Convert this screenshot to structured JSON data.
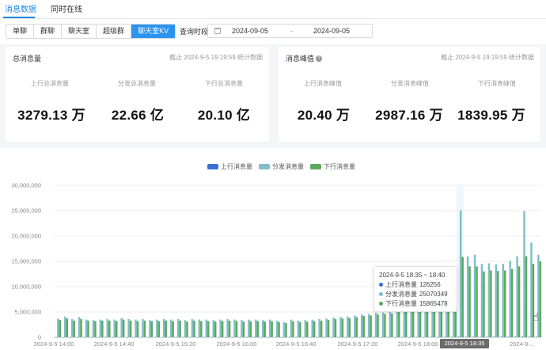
{
  "top_tabs": [
    {
      "label": "消息数据",
      "active": true
    },
    {
      "label": "同时在线",
      "active": false
    }
  ],
  "segments": [
    {
      "label": "单聊",
      "active": false
    },
    {
      "label": "群聊",
      "active": false
    },
    {
      "label": "聊天室",
      "active": false
    },
    {
      "label": "超级群",
      "active": false
    },
    {
      "label": "聊天室KV",
      "active": true
    }
  ],
  "query": {
    "label": "查询时段",
    "start": "2024-09-05",
    "separator": "-",
    "end": "2024-09-05"
  },
  "cards": [
    {
      "title": "总消息量",
      "help": false,
      "meta": "截止 2024-9-5 19:19:59 统计数据",
      "stats": [
        {
          "label": "上行总消息量",
          "value": "3279.13 万"
        },
        {
          "label": "分发总消息量",
          "value": "22.66 亿"
        },
        {
          "label": "下行总消息量",
          "value": "20.10 亿"
        }
      ]
    },
    {
      "title": "消息峰值",
      "help": true,
      "meta": "截止 2024-9-5 19:19:59 统计数据",
      "stats": [
        {
          "label": "上行消息峰值",
          "value": "20.40 万"
        },
        {
          "label": "分发消息峰值",
          "value": "2987.16 万"
        },
        {
          "label": "下行消息峰值",
          "value": "1839.95 万"
        }
      ]
    }
  ],
  "colors": {
    "accent": "#2b93f0",
    "up": "#3b6fd8",
    "dist": "#7fbfc9",
    "down": "#5ea85e"
  },
  "chart_data": {
    "type": "bar",
    "legend": [
      "上行消息量",
      "分发消息量",
      "下行消息量"
    ],
    "ylim": [
      0,
      30000000
    ],
    "yticks": [
      "0",
      "5,000,000",
      "10,000,000",
      "15,000,000",
      "20,000,000",
      "25,000,000",
      "30,000,000"
    ],
    "xticks": [
      "2024-9-5 14:00",
      "2024-9-5 14:40",
      "2024-9-5 15:20",
      "2024-9-5 16:00",
      "2024-9-5 16:40",
      "2024-9-5 17:20",
      "2024-9-5 18:00",
      "2024-9-5 18:35",
      "2024-9-..."
    ],
    "series": [
      {
        "name": "上行消息量",
        "values": [
          20000,
          22000,
          21000,
          22000,
          20000,
          21000,
          20000,
          21000,
          20000,
          22000,
          21000,
          20000,
          21000,
          20000,
          21000,
          20000,
          22000,
          21000,
          20000,
          21000,
          21000,
          20000,
          21000,
          20000,
          21000,
          20000,
          21000,
          20000,
          21000,
          21000,
          20000,
          21000,
          20000,
          21000,
          21000,
          20000,
          21000,
          20000,
          20000,
          22000,
          21000,
          20000,
          21000,
          21000,
          22000,
          23000,
          24000,
          25000,
          26000,
          27000,
          28000,
          30000,
          32000,
          35000,
          40000,
          60000,
          80000,
          126256,
          100000,
          90000,
          85000,
          85000,
          90000,
          95000,
          100000,
          120000,
          140000,
          110000,
          100000
        ]
      },
      {
        "name": "分发消息量",
        "values": [
          3700000,
          4100000,
          3600000,
          4000000,
          3500000,
          3400000,
          3500000,
          3600000,
          3500000,
          3800000,
          3600000,
          3500000,
          3600000,
          3400000,
          3500000,
          3600000,
          3500000,
          3600000,
          3400000,
          3600000,
          3500000,
          3500000,
          3400000,
          3500000,
          3600000,
          3500000,
          3400000,
          3500000,
          3500000,
          3400000,
          3500000,
          3300000,
          3000000,
          3500000,
          3300000,
          3400000,
          3500000,
          3600000,
          3700000,
          3900000,
          4000000,
          4100000,
          4300000,
          4500000,
          4600000,
          4800000,
          4900000,
          5000000,
          5300000,
          5500000,
          5800000,
          6300000,
          7200000,
          8000000,
          9000000,
          10000000,
          13800000,
          25070349,
          16000000,
          16300000,
          14500000,
          14600000,
          14400000,
          14500000,
          15100000,
          16000000,
          24900000,
          18700000,
          16300000
        ]
      },
      {
        "name": "下行消息量",
        "values": [
          3400000,
          3700000,
          3300000,
          3600000,
          3300000,
          3200000,
          3300000,
          3300000,
          3200000,
          3500000,
          3300000,
          3200000,
          3300000,
          3200000,
          3200000,
          3300000,
          3200000,
          3300000,
          3100000,
          3300000,
          3200000,
          3200000,
          3100000,
          3200000,
          3300000,
          3200000,
          3100000,
          3200000,
          3200000,
          3100000,
          3200000,
          3000000,
          2800000,
          3200000,
          3000000,
          3100000,
          3200000,
          3300000,
          3400000,
          3600000,
          3700000,
          3800000,
          4000000,
          4200000,
          4300000,
          4500000,
          4600000,
          4700000,
          5000000,
          5200000,
          5400000,
          6000000,
          6800000,
          7500000,
          8500000,
          9500000,
          12800000,
          15865478,
          14000000,
          14000000,
          13000000,
          13200000,
          13100000,
          13200000,
          13500000,
          14000000,
          16000000,
          14500000,
          15000000
        ]
      }
    ],
    "highlight_index": 57,
    "tooltip": {
      "title": "2024-9-5 18:35 ~ 18:40",
      "rows": [
        {
          "name": "上行消息量",
          "value": "126256"
        },
        {
          "name": "分发消息量",
          "value": "25070349"
        },
        {
          "name": "下行消息量",
          "value": "15865478"
        }
      ]
    },
    "highlight_label": "2024-9-5 18:35",
    "grid": true,
    "legend_position": "top-center"
  }
}
